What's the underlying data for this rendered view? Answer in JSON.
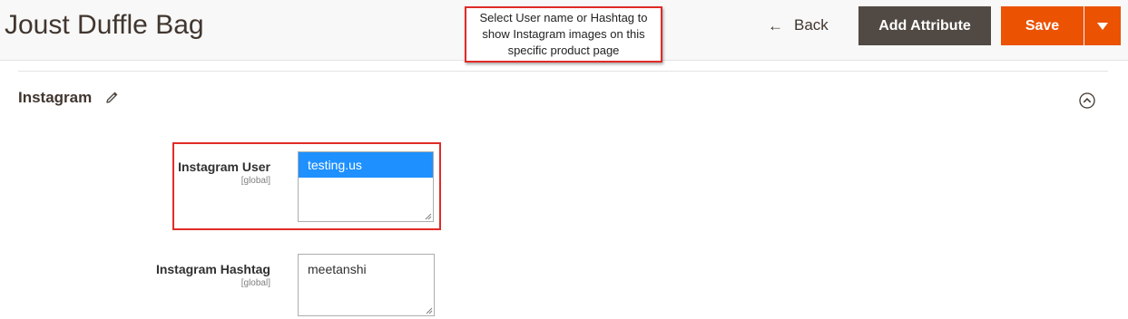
{
  "header": {
    "title": "Joust Duffle Bag",
    "back_label": "Back",
    "add_attribute_label": "Add Attribute",
    "save_label": "Save"
  },
  "callout": {
    "text": "Select User name or Hashtag to show Instagram images on this specific product page"
  },
  "section": {
    "title": "Instagram"
  },
  "fields": {
    "instagram_user": {
      "label": "Instagram User",
      "scope": "[global]",
      "selected_value": "testing.us"
    },
    "instagram_hashtag": {
      "label": "Instagram Hashtag",
      "scope": "[global]",
      "value": "meetanshi"
    }
  },
  "colors": {
    "save_orange": "#eb5202",
    "add_attribute_brown": "#514943",
    "highlight_red": "#e02b27",
    "selected_option_blue": "#1e90ff"
  },
  "icons": {
    "back": "arrow-left-icon",
    "edit": "pencil-icon",
    "collapse": "chevron-up-circle-icon",
    "save_menu": "caret-down-icon"
  }
}
